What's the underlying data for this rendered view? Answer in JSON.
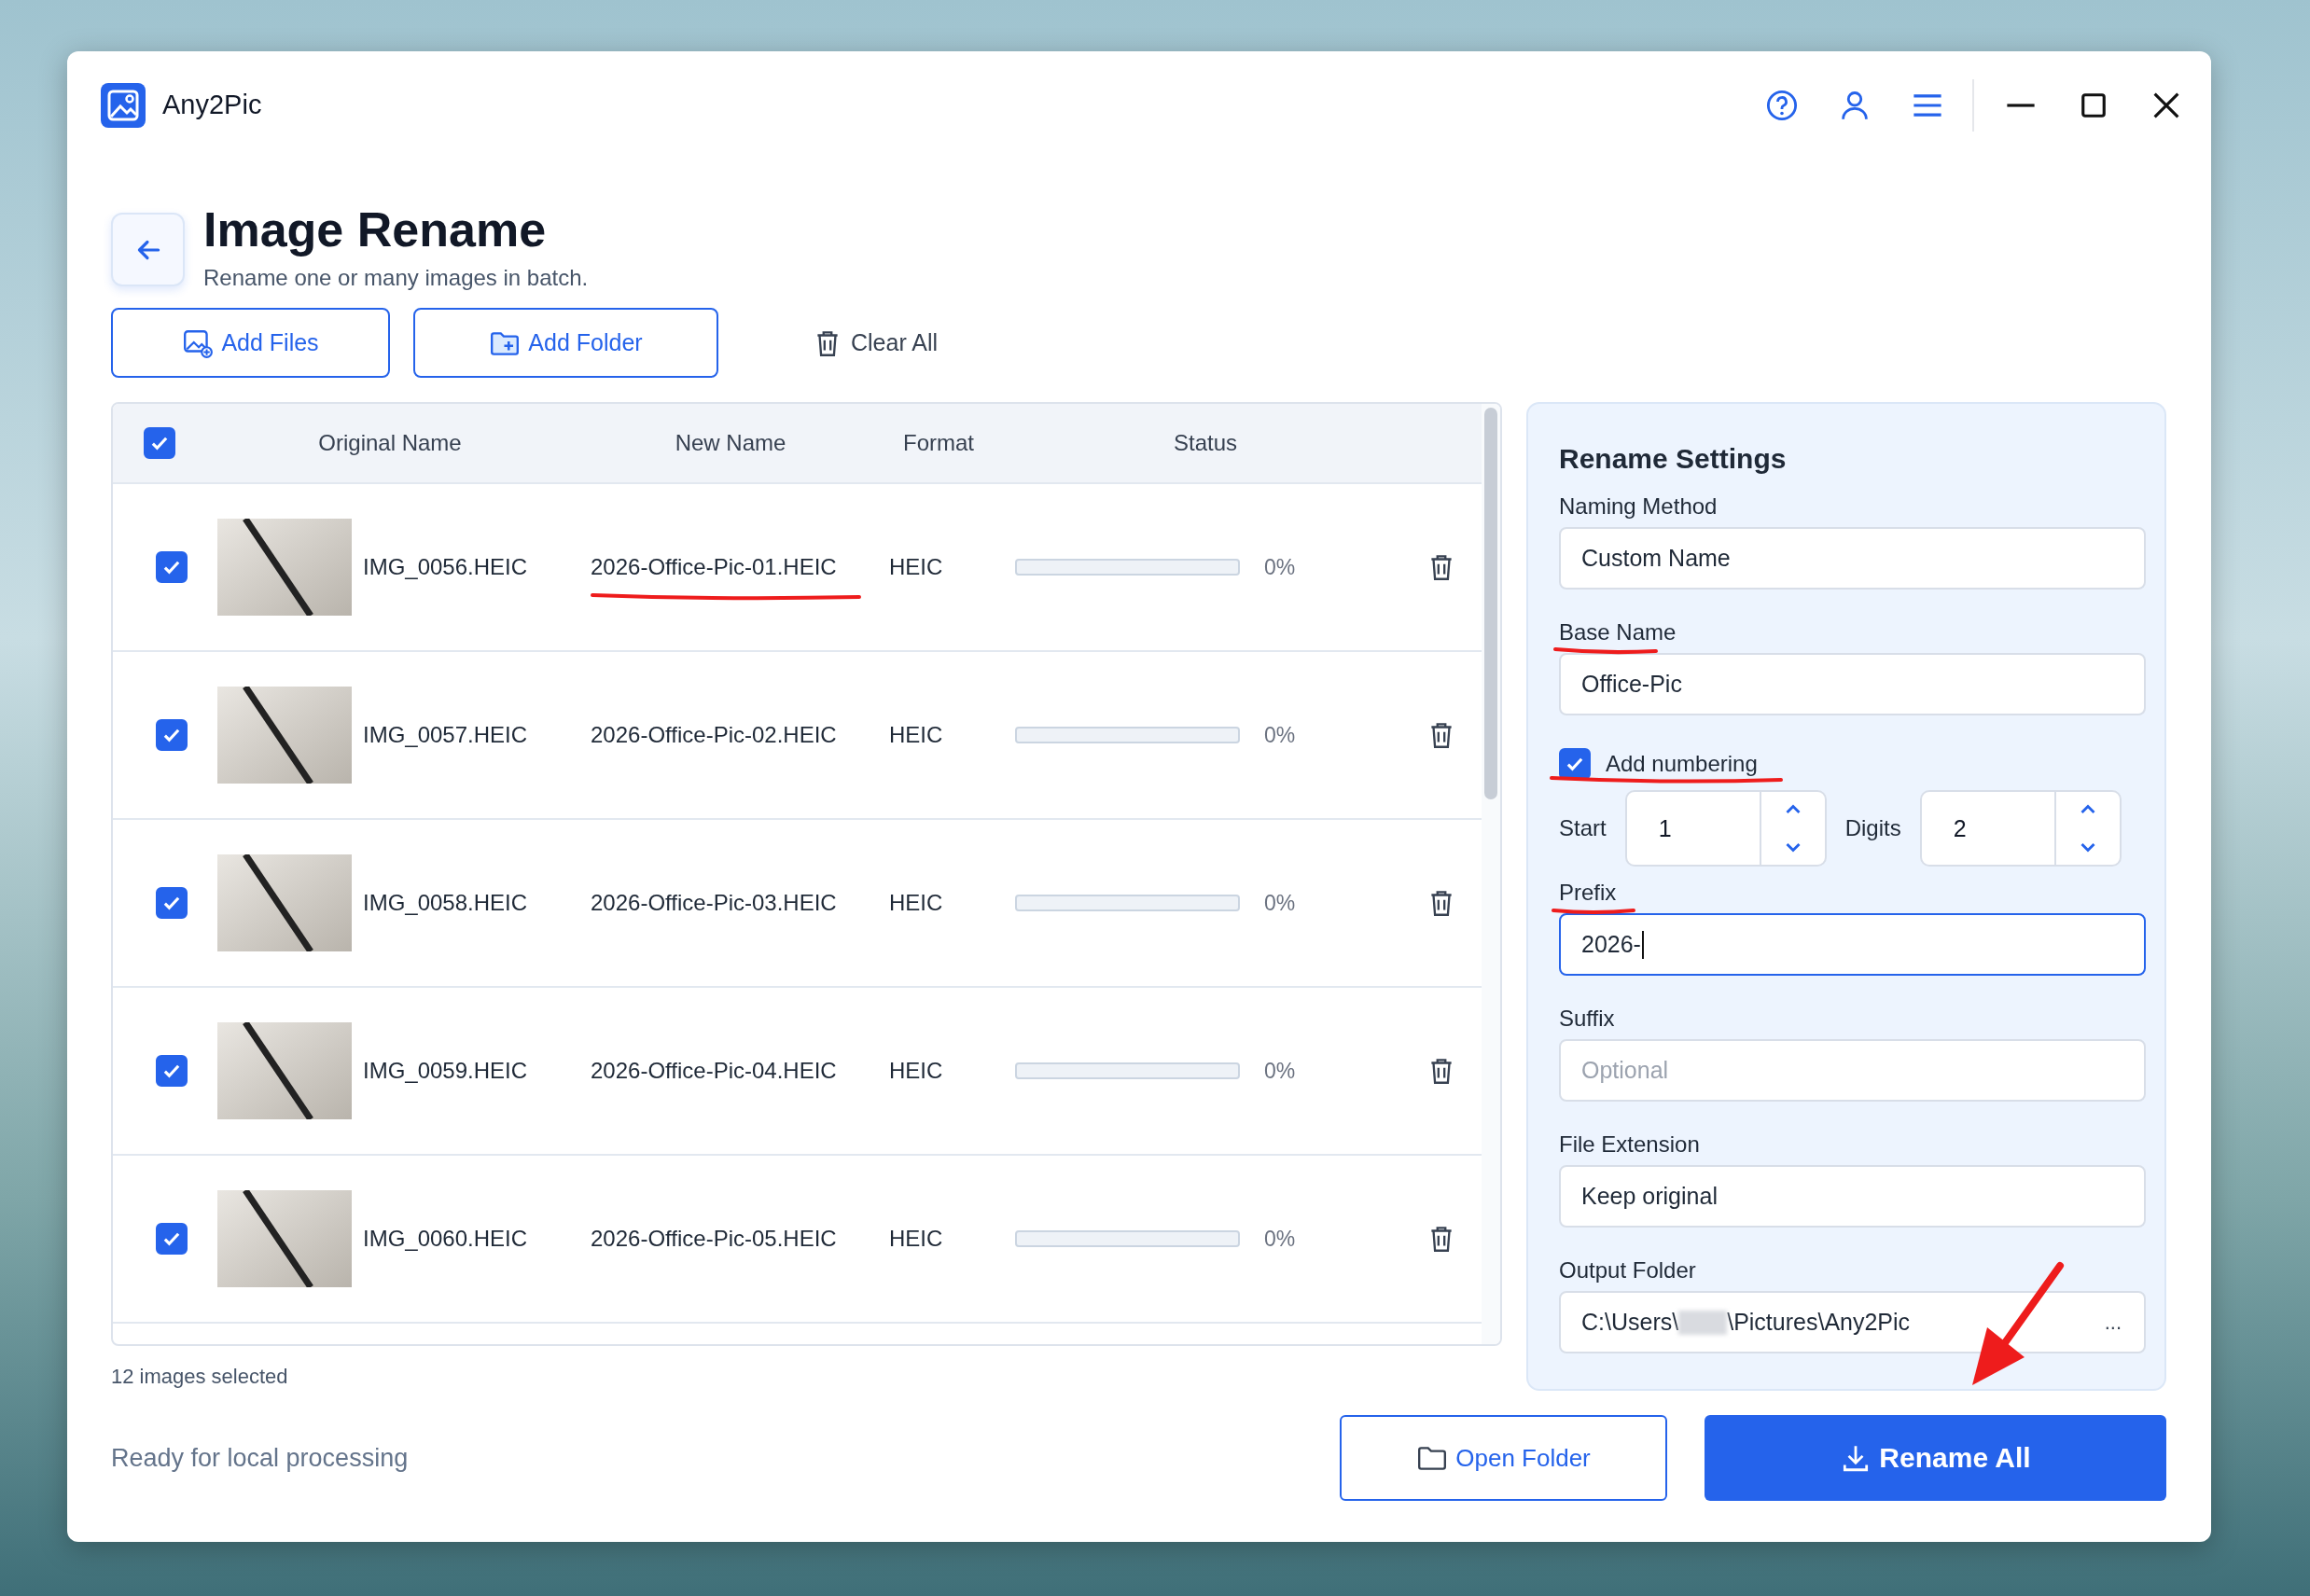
{
  "app": {
    "title": "Any2Pic"
  },
  "page": {
    "title": "Image Rename",
    "subtitle": "Rename one or many images in batch."
  },
  "toolbar": [
    {
      "label": "Add Files",
      "kind": "outline"
    },
    {
      "label": "Add Folder",
      "kind": "outline"
    },
    {
      "label": "Clear All",
      "kind": "plain"
    }
  ],
  "table": {
    "select_all": {
      "checked": true
    },
    "columns": [
      "Original Name",
      "New Name",
      "Format",
      "Status"
    ],
    "rows": [
      {
        "checked": true,
        "original": "IMG_0056.HEIC",
        "new_name": "2026-Office-Pic-01.HEIC",
        "format": "HEIC",
        "level": 0,
        "percent": "0%",
        "marked": true
      },
      {
        "checked": true,
        "original": "IMG_0057.HEIC",
        "new_name": "2026-Office-Pic-02.HEIC",
        "format": "HEIC",
        "level": 0,
        "percent": "0%",
        "marked": false
      },
      {
        "checked": true,
        "original": "IMG_0058.HEIC",
        "new_name": "2026-Office-Pic-03.HEIC",
        "format": "HEIC",
        "level": 0,
        "percent": "0%",
        "marked": false
      },
      {
        "checked": true,
        "original": "IMG_0059.HEIC",
        "new_name": "2026-Office-Pic-04.HEIC",
        "format": "HEIC",
        "level": 0,
        "percent": "0%",
        "marked": false
      },
      {
        "checked": true,
        "original": "IMG_0060.HEIC",
        "new_name": "2026-Office-Pic-05.HEIC",
        "format": "HEIC",
        "level": 0,
        "percent": "0%",
        "marked": false
      }
    ]
  },
  "selection_count": "12 images selected",
  "status": "Ready for local processing",
  "settings": {
    "title": "Rename Settings",
    "naming_method": {
      "label": "Naming Method",
      "value": "Custom Name",
      "marked": false
    },
    "base_name": {
      "label": "Base Name",
      "value": "Office-Pic",
      "marked": true
    },
    "add_numbering": {
      "label": "Add numbering",
      "checked": true,
      "marked": true
    },
    "start": {
      "label": "Start",
      "value": "1"
    },
    "digits": {
      "label": "Digits",
      "value": "2"
    },
    "prefix": {
      "label": "Prefix",
      "value": "2026-",
      "focused": true,
      "marked": true
    },
    "suffix": {
      "label": "Suffix",
      "placeholder": "Optional",
      "marked": false
    },
    "file_extension": {
      "label": "File Extension",
      "value": "Keep original",
      "marked": false
    },
    "output_folder": {
      "label": "Output Folder",
      "value_start": "C:\\Users\\",
      "value_end": "\\Pictures\\Any2Pic",
      "browse": "..."
    }
  },
  "buttons": [
    {
      "label": "Open Folder",
      "kind": "secondary"
    },
    {
      "label": "Rename All",
      "kind": "primary"
    }
  ]
}
